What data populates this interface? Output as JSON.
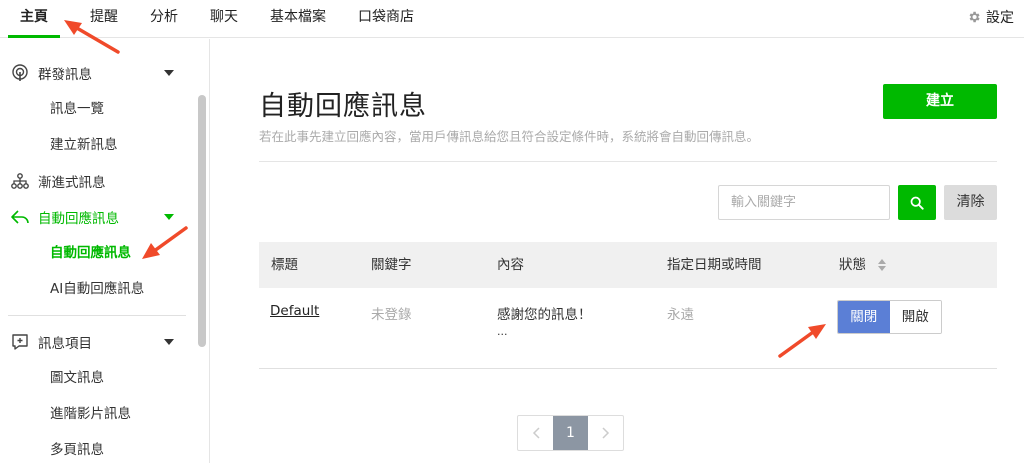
{
  "nav": {
    "tabs": [
      "主頁",
      "提醒",
      "分析",
      "聊天",
      "基本檔案",
      "口袋商店"
    ],
    "settings_label": "設定"
  },
  "sidebar": {
    "group1": {
      "label": "群發訊息",
      "items": [
        "訊息一覽",
        "建立新訊息"
      ]
    },
    "step_label": "漸進式訊息",
    "group2": {
      "label": "自動回應訊息",
      "items": [
        "自動回應訊息",
        "AI自動回應訊息"
      ]
    },
    "group3": {
      "label": "訊息項目",
      "items": [
        "圖文訊息",
        "進階影片訊息",
        "多頁訊息"
      ]
    }
  },
  "page": {
    "title": "自動回應訊息",
    "description": "若在此事先建立回應內容，當用戶傳訊息給您且符合設定條件時，系統將會自動回傳訊息。",
    "create_label": "建立",
    "search_placeholder": "輸入關鍵字",
    "clear_label": "清除"
  },
  "table": {
    "headers": [
      "標題",
      "關鍵字",
      "內容",
      "指定日期或時間",
      "狀態"
    ],
    "rows": [
      {
        "title": "Default",
        "keyword": "未登錄",
        "content": "感謝您的訊息！",
        "content_more": "...",
        "schedule": "永遠",
        "status_off": "關閉",
        "status_on": "開啟"
      }
    ]
  },
  "pagination": {
    "current": "1"
  },
  "colors": {
    "accent": "#00b900",
    "toggle_active": "#5b7fd6",
    "annotation_arrow": "#f04a2a"
  }
}
